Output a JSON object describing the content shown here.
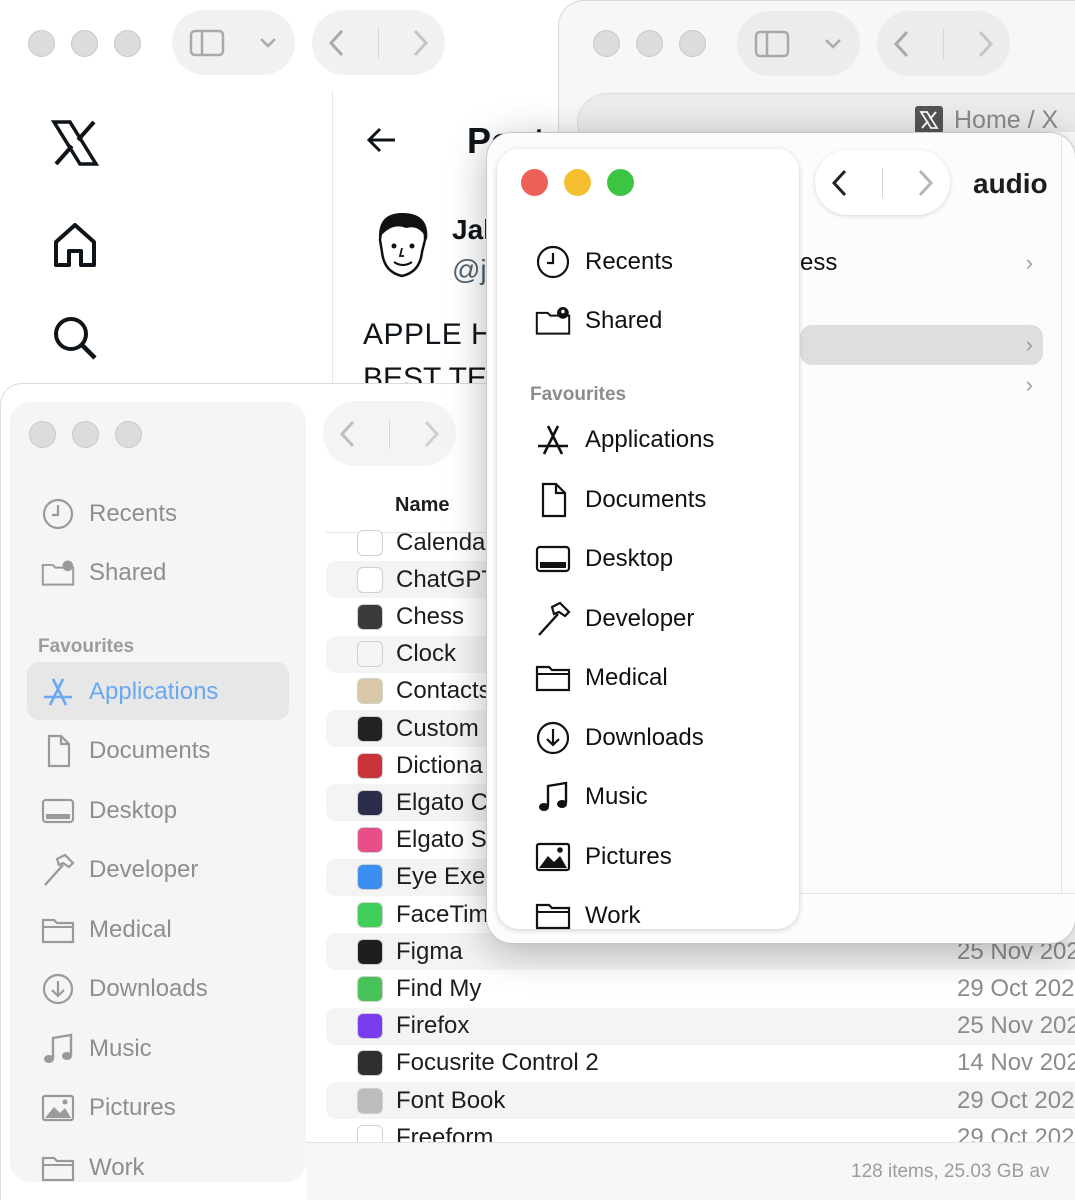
{
  "x_window": {
    "post_title": "Post",
    "author_name": "Jal",
    "author_handle": "@j",
    "tweet_line1": "APPLE H",
    "tweet_line2": "BEST TE"
  },
  "safari_window": {
    "tab_title": "Home / X"
  },
  "back_finder": {
    "list_header": "Name",
    "sidebar": {
      "recents": "Recents",
      "shared": "Shared",
      "favourites_header": "Favourites",
      "items": [
        "Applications",
        "Documents",
        "Desktop",
        "Developer",
        "Medical",
        "Downloads",
        "Music",
        "Pictures",
        "Work"
      ]
    },
    "files": [
      {
        "name": "Calenda",
        "date": "",
        "color": "#ffffff"
      },
      {
        "name": "ChatGPT",
        "date": "",
        "color": "#ffffff"
      },
      {
        "name": "Chess",
        "date": "",
        "color": "#3a3a3a"
      },
      {
        "name": "Clock",
        "date": "",
        "color": "#f4f4f4"
      },
      {
        "name": "Contacts",
        "date": "",
        "color": "#d9c8a8"
      },
      {
        "name": "Custom",
        "date": "",
        "color": "#222222"
      },
      {
        "name": "Dictiona",
        "date": "",
        "color": "#c9343a"
      },
      {
        "name": "Elgato C",
        "date": "",
        "color": "#2b2d4a"
      },
      {
        "name": "Elgato S",
        "date": "",
        "color": "#e84f8a"
      },
      {
        "name": "Eye Exer",
        "date": "",
        "color": "#3a8ff0"
      },
      {
        "name": "FaceTime",
        "date": "",
        "color": "#3fcf5a"
      },
      {
        "name": "Figma",
        "date": "25 Nov 202",
        "color": "#1e1e1e"
      },
      {
        "name": "Find My",
        "date": "29 Oct 202",
        "color": "#47c35a"
      },
      {
        "name": "Firefox",
        "date": "25 Nov 202",
        "color": "#7b3cf0"
      },
      {
        "name": "Focusrite Control 2",
        "date": "14 Nov 202",
        "color": "#2f2f2f"
      },
      {
        "name": "Font Book",
        "date": "29 Oct 202",
        "color": "#bcbcbc"
      },
      {
        "name": "Freeform",
        "date": "29 Oct 202",
        "color": "#ffffff"
      }
    ],
    "status": "128 items, 25.03 GB av"
  },
  "front_finder": {
    "path_title": "audio",
    "sidebar": {
      "recents": "Recents",
      "shared": "Shared",
      "favourites_header": "Favourites",
      "items": [
        "Applications",
        "Documents",
        "Desktop",
        "Developer",
        "Medical",
        "Downloads",
        "Music",
        "Pictures",
        "Work"
      ]
    },
    "rows": [
      {
        "label": "ess"
      },
      {
        "label": ""
      },
      {
        "label": ""
      }
    ],
    "traffic_colors": {
      "close": "#ee5f57",
      "minimize": "#f5be2f",
      "zoom": "#3dc443"
    }
  }
}
